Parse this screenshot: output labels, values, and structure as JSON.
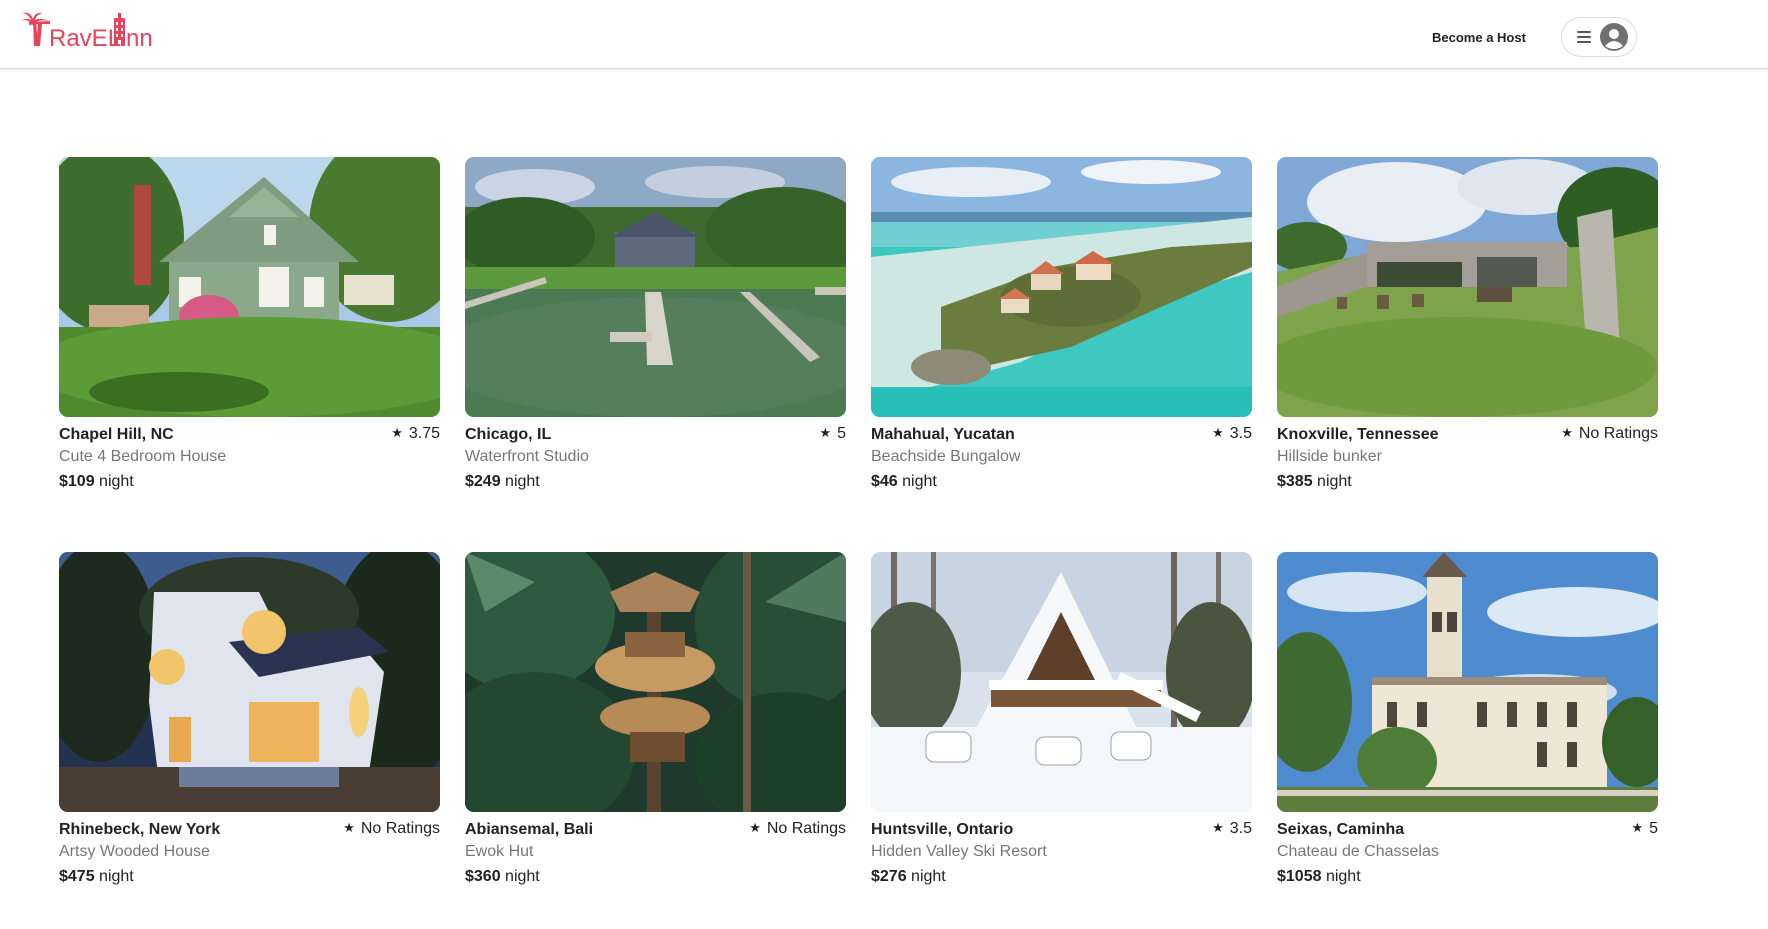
{
  "brand": {
    "logo_text": "TravelInn",
    "color": "#E8425C"
  },
  "header": {
    "become_host_label": "Become a Host"
  },
  "listings": [
    {
      "city": "Chapel Hill, NC",
      "rating": "3.75",
      "title": "Cute 4 Bedroom House",
      "price": "$109",
      "unit": "night",
      "photo": "green-farmhouse-photo"
    },
    {
      "city": "Chicago, IL",
      "rating": "5",
      "title": "Waterfront Studio",
      "price": "$249",
      "unit": "night",
      "photo": "lakefront-dock-photo"
    },
    {
      "city": "Mahahual, Yucatan",
      "rating": "3.5",
      "title": "Beachside Bungalow",
      "price": "$46",
      "unit": "night",
      "photo": "tropical-island-photo"
    },
    {
      "city": "Knoxville, Tennessee",
      "rating": "No Ratings",
      "title": "Hillside bunker",
      "price": "$385",
      "unit": "night",
      "photo": "concrete-bunker-photo"
    },
    {
      "city": "Rhinebeck, New York",
      "rating": "No Ratings",
      "title": "Artsy Wooded House",
      "price": "$475",
      "unit": "night",
      "photo": "modern-white-house-photo"
    },
    {
      "city": "Abiansemal, Bali",
      "rating": "No Ratings",
      "title": "Ewok Hut",
      "price": "$360",
      "unit": "night",
      "photo": "jungle-treehouse-photo"
    },
    {
      "city": "Huntsville, Ontario",
      "rating": "3.5",
      "title": "Hidden Valley Ski Resort",
      "price": "$276",
      "unit": "night",
      "photo": "snowy-a-frame-photo"
    },
    {
      "city": "Seixas, Caminha",
      "rating": "5",
      "title": "Chateau de Chasselas",
      "price": "$1058",
      "unit": "night",
      "photo": "chateau-tower-photo"
    }
  ]
}
